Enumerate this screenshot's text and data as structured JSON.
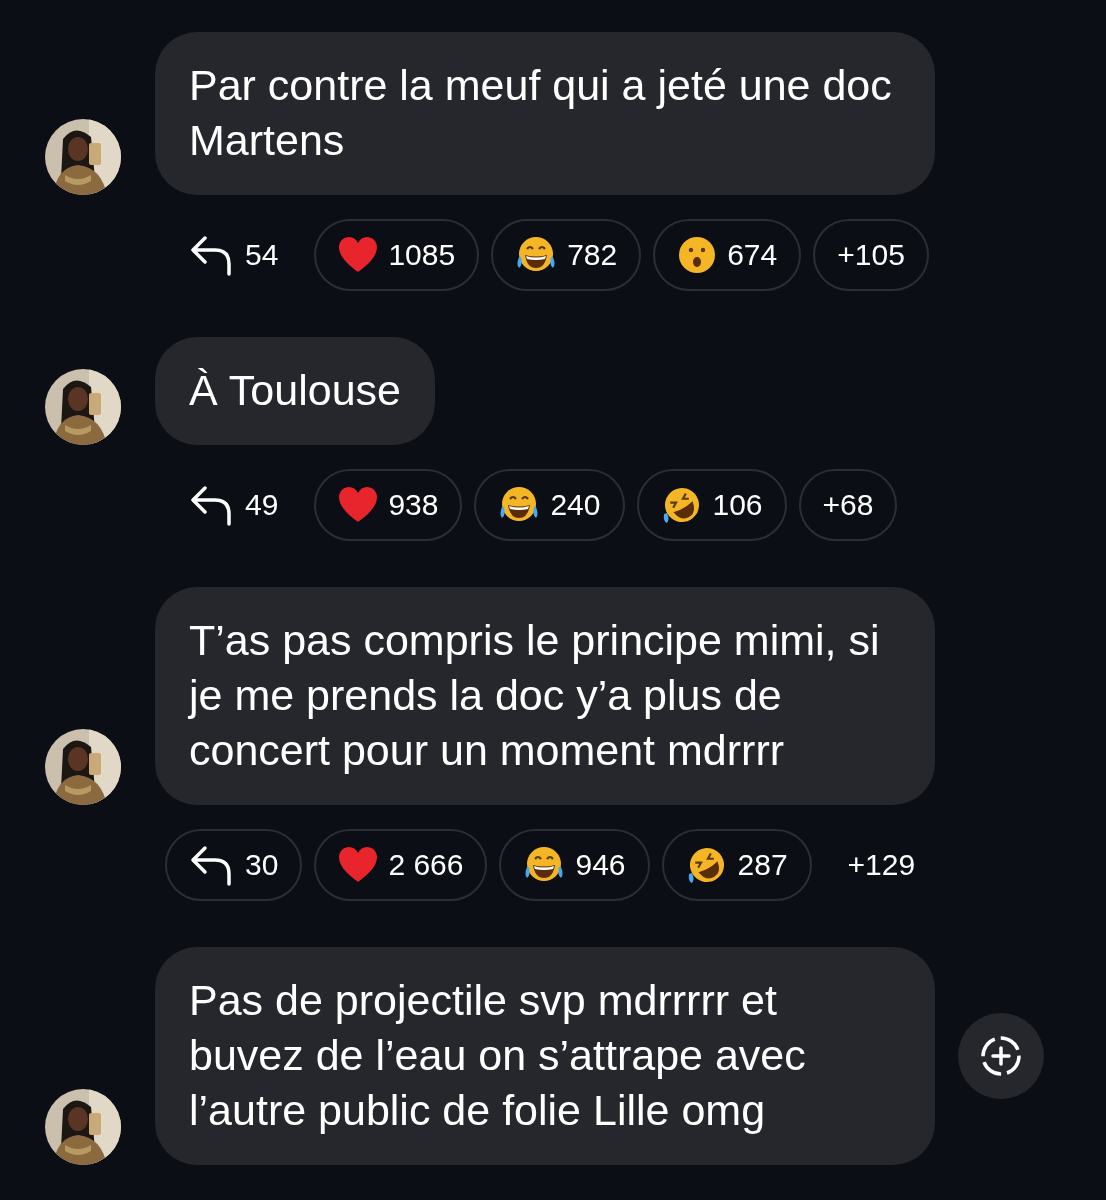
{
  "messages": [
    {
      "text": "Par contre la meuf qui a jeté une doc Martens",
      "add_reaction": false,
      "reactions": [
        {
          "kind": "reply",
          "count": "54",
          "outlined": false
        },
        {
          "kind": "heart",
          "count": "1085",
          "outlined": true
        },
        {
          "kind": "joy",
          "count": "782",
          "outlined": true
        },
        {
          "kind": "surprised",
          "count": "674",
          "outlined": true
        },
        {
          "kind": "more",
          "count": "+105",
          "outlined": true
        }
      ]
    },
    {
      "text": "À Toulouse",
      "add_reaction": false,
      "reactions": [
        {
          "kind": "reply",
          "count": "49",
          "outlined": false
        },
        {
          "kind": "heart",
          "count": "938",
          "outlined": true
        },
        {
          "kind": "joy",
          "count": "240",
          "outlined": true
        },
        {
          "kind": "rofl",
          "count": "106",
          "outlined": true
        },
        {
          "kind": "more",
          "count": "+68",
          "outlined": true
        }
      ]
    },
    {
      "text": "T’as pas compris le principe mimi, si je me prends la doc y’a plus de concert pour un moment mdrrrr",
      "add_reaction": false,
      "reactions": [
        {
          "kind": "reply",
          "count": "30",
          "outlined": true
        },
        {
          "kind": "heart",
          "count": "2 666",
          "outlined": true
        },
        {
          "kind": "joy",
          "count": "946",
          "outlined": true
        },
        {
          "kind": "rofl",
          "count": "287",
          "outlined": true
        },
        {
          "kind": "more",
          "count": "+129",
          "outlined": false
        }
      ]
    },
    {
      "text": "Pas de projectile svp mdrrrrr et buvez de l’eau on s’attrape avec l’autre public de folie Lille omg",
      "add_reaction": true
    }
  ]
}
